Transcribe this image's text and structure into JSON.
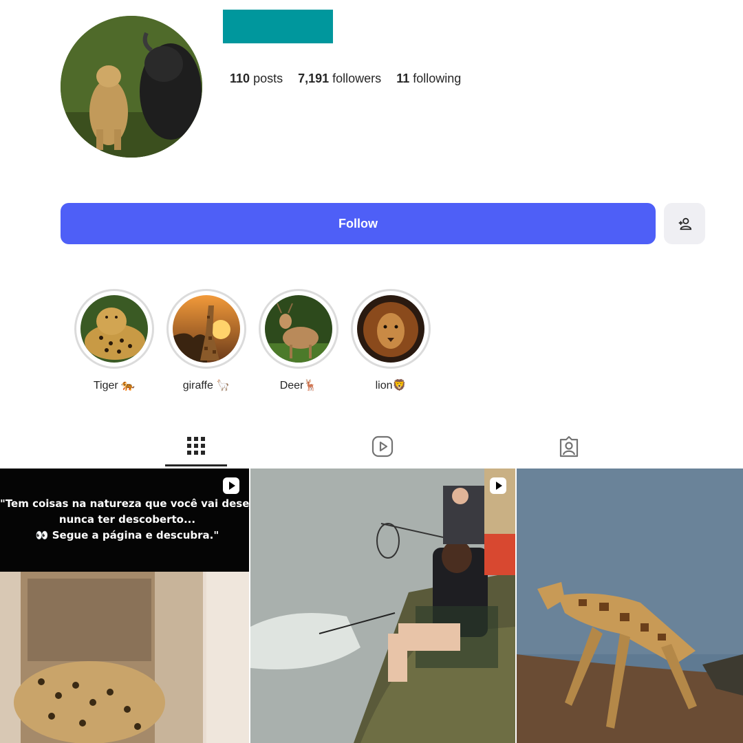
{
  "profile": {
    "username_color": "#00979d",
    "stats": [
      {
        "value": "110",
        "label": "posts"
      },
      {
        "value": "7,191",
        "label": "followers"
      },
      {
        "value": "11",
        "label": "following"
      }
    ]
  },
  "actions": {
    "follow_label": "Follow",
    "follow_color": "#4e5ff7",
    "add_icon": "person-add-icon"
  },
  "highlights": [
    {
      "label": "Tiger 🐅",
      "icon": "leopard-image"
    },
    {
      "label": "giraffe 🦙",
      "icon": "giraffe-image"
    },
    {
      "label": "Deer🦌",
      "icon": "deer-image"
    },
    {
      "label": "lion🦁",
      "icon": "lion-image"
    }
  ],
  "tabs": [
    {
      "icon": "grid-icon",
      "active": true
    },
    {
      "icon": "reels-icon",
      "active": false
    },
    {
      "icon": "tagged-icon",
      "active": false
    }
  ],
  "posts": [
    {
      "type": "reel",
      "caption_lines": [
        "\"Tem coisas na natureza que você vai desejar",
        "nunca ter descoberto...",
        "👀 Segue a página e descubra.\""
      ]
    },
    {
      "type": "reel"
    },
    {
      "type": "image"
    }
  ]
}
